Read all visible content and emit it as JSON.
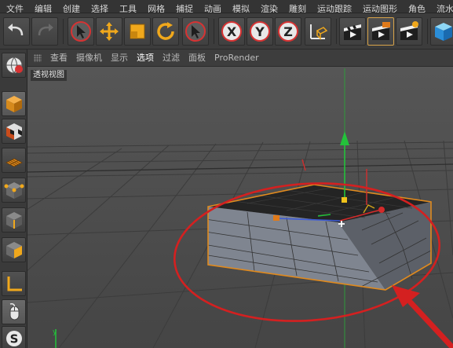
{
  "menubar": {
    "items": [
      "文件",
      "编辑",
      "创建",
      "选择",
      "工具",
      "网格",
      "捕捉",
      "动画",
      "模拟",
      "渲染",
      "雕刻",
      "运动跟踪",
      "运动图形",
      "角色",
      "流水线"
    ]
  },
  "toolbar": {
    "buttons": [
      "undo-icon",
      "redo-icon",
      "select-cursor-icon",
      "move-icon",
      "scale-icon",
      "rotate-icon",
      "live-select-icon",
      "x-axis-icon",
      "y-axis-icon",
      "z-axis-icon",
      "coordinate-system-icon",
      "render-view-icon",
      "render-picture-viewer-icon",
      "render-settings-icon",
      "cube-icon"
    ]
  },
  "viewport_menu": {
    "items": [
      "查看",
      "摄像机",
      "显示",
      "选项",
      "过滤",
      "面板",
      "ProRender"
    ],
    "highlighted": "选项"
  },
  "viewport": {
    "label": "透视视图"
  },
  "colors": {
    "annotation_red": "#d42020",
    "selection_orange": "#e08a1e",
    "y_axis": "#23c23a",
    "x_axis": "#d42a2a",
    "z_axis": "#3d5bd6"
  }
}
